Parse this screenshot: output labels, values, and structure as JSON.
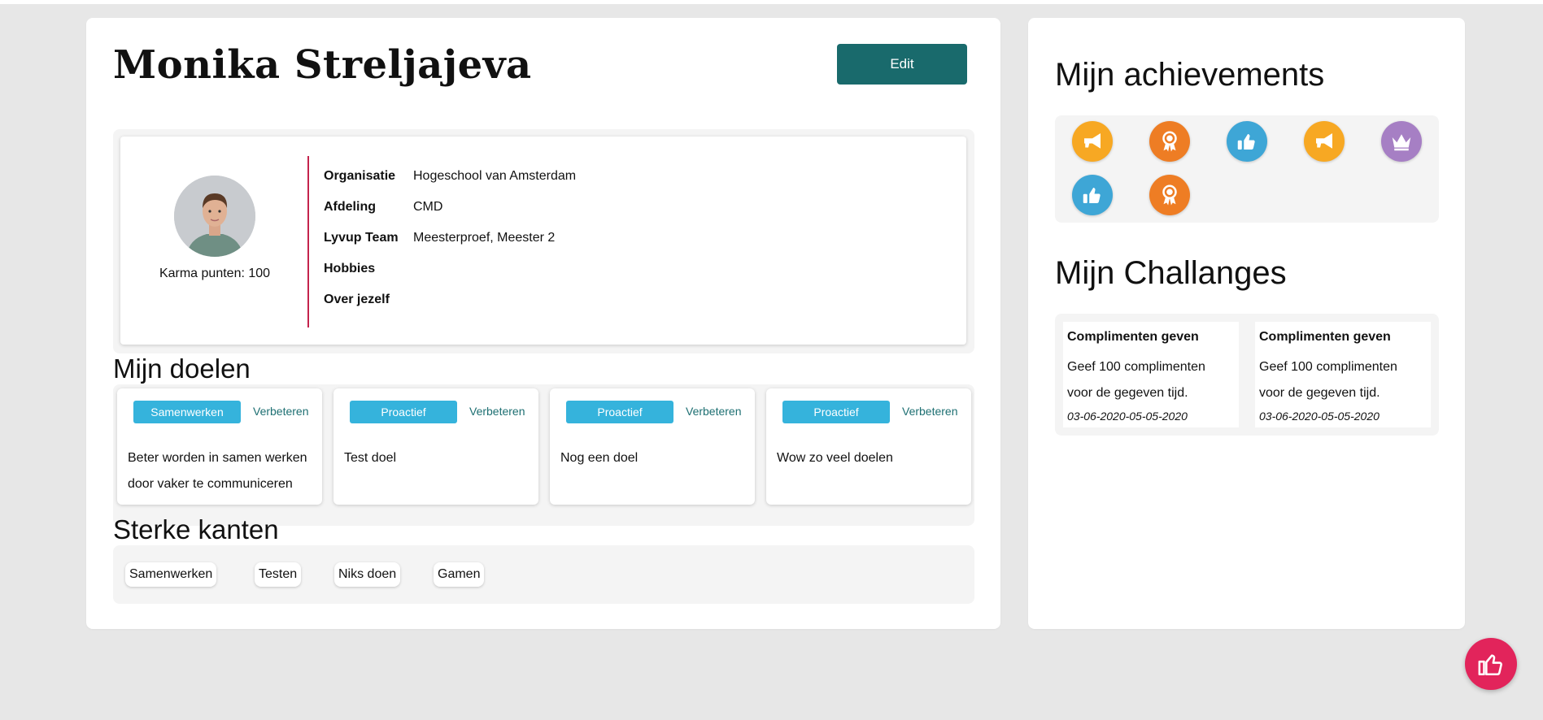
{
  "profile": {
    "name": "Monika Streljajeva",
    "edit_label": "Edit",
    "karma": "Karma punten: 100",
    "fields": [
      {
        "label": "Organisatie",
        "value": "Hogeschool van Amsterdam"
      },
      {
        "label": "Afdeling",
        "value": "CMD"
      },
      {
        "label": "Lyvup Team",
        "value": "Meesterproef, Meester 2"
      },
      {
        "label": "Hobbies",
        "value": ""
      },
      {
        "label": "Over jezelf",
        "value": ""
      }
    ]
  },
  "goals": {
    "title": "Mijn doelen",
    "items": [
      {
        "tag": "Samenwerken",
        "action": "Verbeteren",
        "text": "Beter worden in samen werken door vaker te communiceren"
      },
      {
        "tag": "Proactief",
        "action": "Verbeteren",
        "text": "Test doel"
      },
      {
        "tag": "Proactief",
        "action": "Verbeteren",
        "text": "Nog een doel"
      },
      {
        "tag": "Proactief",
        "action": "Verbeteren",
        "text": "Wow zo veel doelen"
      }
    ]
  },
  "strengths": {
    "title": "Sterke kanten",
    "items": [
      "Samenwerken",
      "Testen",
      "Niks doen",
      "Gamen"
    ]
  },
  "achievements": {
    "title": "Mijn achievements",
    "badges": [
      {
        "icon": "megaphone-icon",
        "color": "#f7a823"
      },
      {
        "icon": "ribbon-icon",
        "color": "#ee7d24"
      },
      {
        "icon": "thumbs-up-icon",
        "color": "#3ea6d6"
      },
      {
        "icon": "megaphone-icon",
        "color": "#f7a823"
      },
      {
        "icon": "crown-icon",
        "color": "#a67fc4"
      },
      {
        "icon": "thumbs-up-icon",
        "color": "#3ea6d6"
      },
      {
        "icon": "ribbon-icon",
        "color": "#ee7d24"
      }
    ]
  },
  "challenges": {
    "title": "Mijn Challanges",
    "items": [
      {
        "title": "Complimenten geven",
        "description": "Geef 100 complimenten voor de gegeven tijd.",
        "dates": "03-06-2020-05-05-2020"
      },
      {
        "title": "Complimenten geven",
        "description": "Geef 100 complimenten voor de gegeven tijd.",
        "dates": "03-06-2020-05-05-2020"
      }
    ]
  },
  "colors": {
    "primary_button": "#196a6c",
    "tag": "#35b3dc",
    "accent_line": "#c4234c",
    "fab": "#e2245b"
  },
  "fab": {
    "icon": "thumbs-up-icon"
  }
}
